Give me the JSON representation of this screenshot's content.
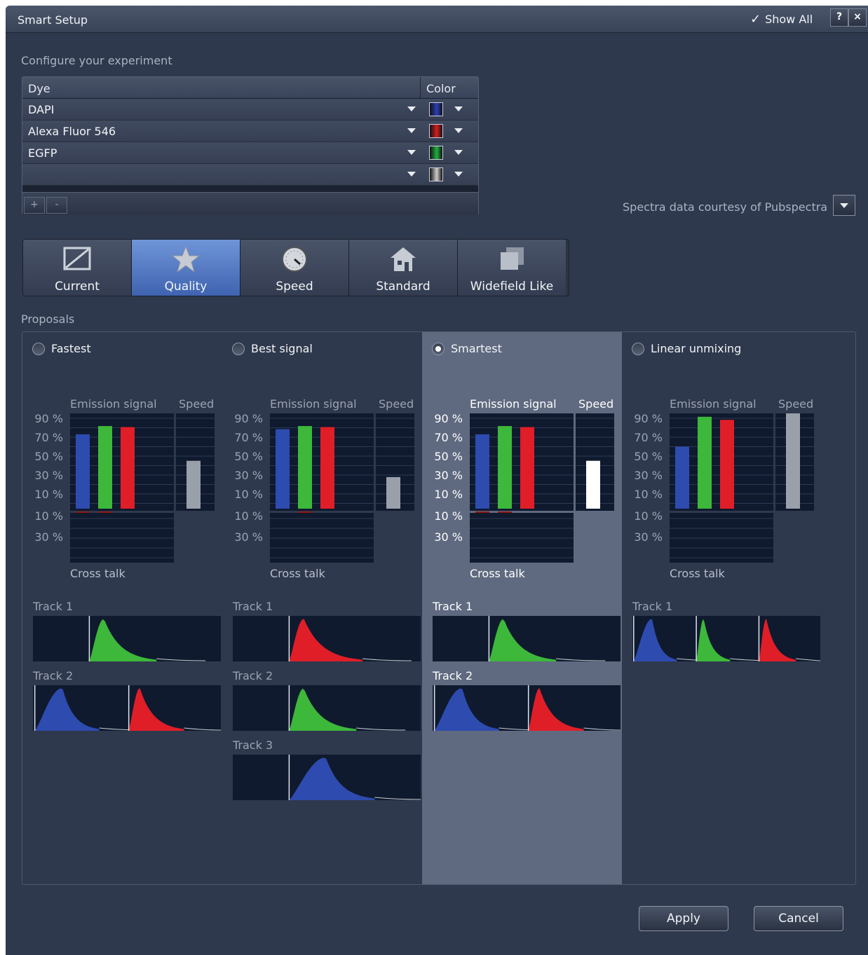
{
  "window": {
    "title": "Smart Setup",
    "show_all": "Show All",
    "help": "?",
    "close": "×"
  },
  "configure_label": "Configure your experiment",
  "dye_table": {
    "col_dye": "Dye",
    "col_color": "Color",
    "rows": [
      {
        "name": "DAPI",
        "color": "#2a3fb8"
      },
      {
        "name": "Alexa Fluor 546",
        "color": "#d41e1e"
      },
      {
        "name": "EGFP",
        "color": "#20b040"
      },
      {
        "name": "",
        "color": "#cccccc"
      }
    ],
    "add": "+",
    "remove": "-"
  },
  "spectra_note": "Spectra data courtesy of Pubspectra",
  "modes": [
    {
      "label": "Current",
      "icon": "current-icon",
      "active": false
    },
    {
      "label": "Quality",
      "icon": "star-icon",
      "active": true
    },
    {
      "label": "Speed",
      "icon": "speedometer-icon",
      "active": false
    },
    {
      "label": "Standard",
      "icon": "house-icon",
      "active": false
    },
    {
      "label": "Widefield Like",
      "icon": "widefield-icon",
      "active": false
    }
  ],
  "proposals_label": "Proposals",
  "chart_labels": {
    "emission": "Emission signal",
    "speed": "Speed",
    "crosstalk": "Cross talk",
    "y_top": [
      "90 %",
      "70 %",
      "50 %",
      "30 %",
      "10 %"
    ],
    "y_bottom": [
      "10 %",
      "30 %"
    ]
  },
  "colors": {
    "blue": "#2e4bb0",
    "green": "#3db83a",
    "red": "#e01e28",
    "speed_gray": "#9aa0aa",
    "speed_white": "#ffffff"
  },
  "proposals": [
    {
      "name": "Fastest",
      "selected": false,
      "emission": [
        72,
        80,
        79
      ],
      "speed": 50,
      "crosstalk": [
        true,
        true,
        false
      ],
      "tracks": [
        {
          "label": "Track 1",
          "curves": [
            "green"
          ]
        },
        {
          "label": "Track 2",
          "curves": [
            "blue",
            "red"
          ]
        }
      ]
    },
    {
      "name": "Best signal",
      "selected": false,
      "emission": [
        77,
        80,
        79
      ],
      "speed": 33,
      "crosstalk": [
        false,
        true,
        false
      ],
      "tracks": [
        {
          "label": "Track 1",
          "curves": [
            "red"
          ]
        },
        {
          "label": "Track 2",
          "curves": [
            "green"
          ]
        },
        {
          "label": "Track 3",
          "curves": [
            "blue"
          ]
        }
      ]
    },
    {
      "name": "Smartest",
      "selected": true,
      "emission": [
        72,
        80,
        79
      ],
      "speed": 50,
      "crosstalk": [
        true,
        true,
        false
      ],
      "tracks": [
        {
          "label": "Track 1",
          "curves": [
            "green"
          ]
        },
        {
          "label": "Track 2",
          "curves": [
            "blue",
            "red"
          ]
        }
      ]
    },
    {
      "name": "Linear unmixing",
      "selected": false,
      "emission": [
        60,
        89,
        86
      ],
      "speed": 100,
      "crosstalk": [
        false,
        false,
        false
      ],
      "tracks": [
        {
          "label": "Track 1",
          "curves": [
            "blue",
            "green",
            "red"
          ]
        }
      ]
    }
  ],
  "apply": "Apply",
  "cancel": "Cancel"
}
